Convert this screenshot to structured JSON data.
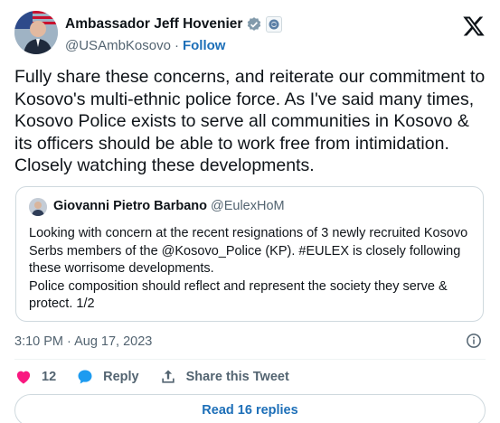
{
  "author": {
    "display_name": "Ambassador Jeff Hovenier",
    "handle": "@USAmbKosovo",
    "separator": "·",
    "follow_label": "Follow"
  },
  "tweet": {
    "text": "Fully share these concerns, and reiterate our commitment to Kosovo's multi-ethnic police force. As I've said many times, Kosovo Police exists to serve all communities in Kosovo & its officers should be able to work free from intimidation. Closely watching these developments."
  },
  "quoted": {
    "display_name": "Giovanni Pietro Barbano",
    "handle": "@EulexHoM",
    "paragraph_1": "Looking with concern at the recent resignations of 3 newly recruited Kosovo Serbs members of the @Kosovo_Police (KP). #EULEX is closely following these worrisome developments.",
    "paragraph_2": "Police composition should reflect and represent the society they serve & protect. 1/2"
  },
  "meta": {
    "timestamp": "3:10 PM · Aug 17, 2023"
  },
  "actions": {
    "like_count": "12",
    "reply_label": "Reply",
    "share_label": "Share this Tweet"
  },
  "footer": {
    "read_replies_label": "Read 16 replies"
  },
  "colors": {
    "accent": "#1d9bf0",
    "link": "#1d6fb8",
    "like": "#f91880",
    "muted": "#536471"
  },
  "icons": {
    "verified": "verified-badge-icon",
    "affiliate": "affiliate-seal-icon",
    "brand": "x-logo-icon",
    "info": "info-icon",
    "like": "heart-icon",
    "reply": "speech-bubble-icon",
    "share": "share-arrow-icon"
  }
}
